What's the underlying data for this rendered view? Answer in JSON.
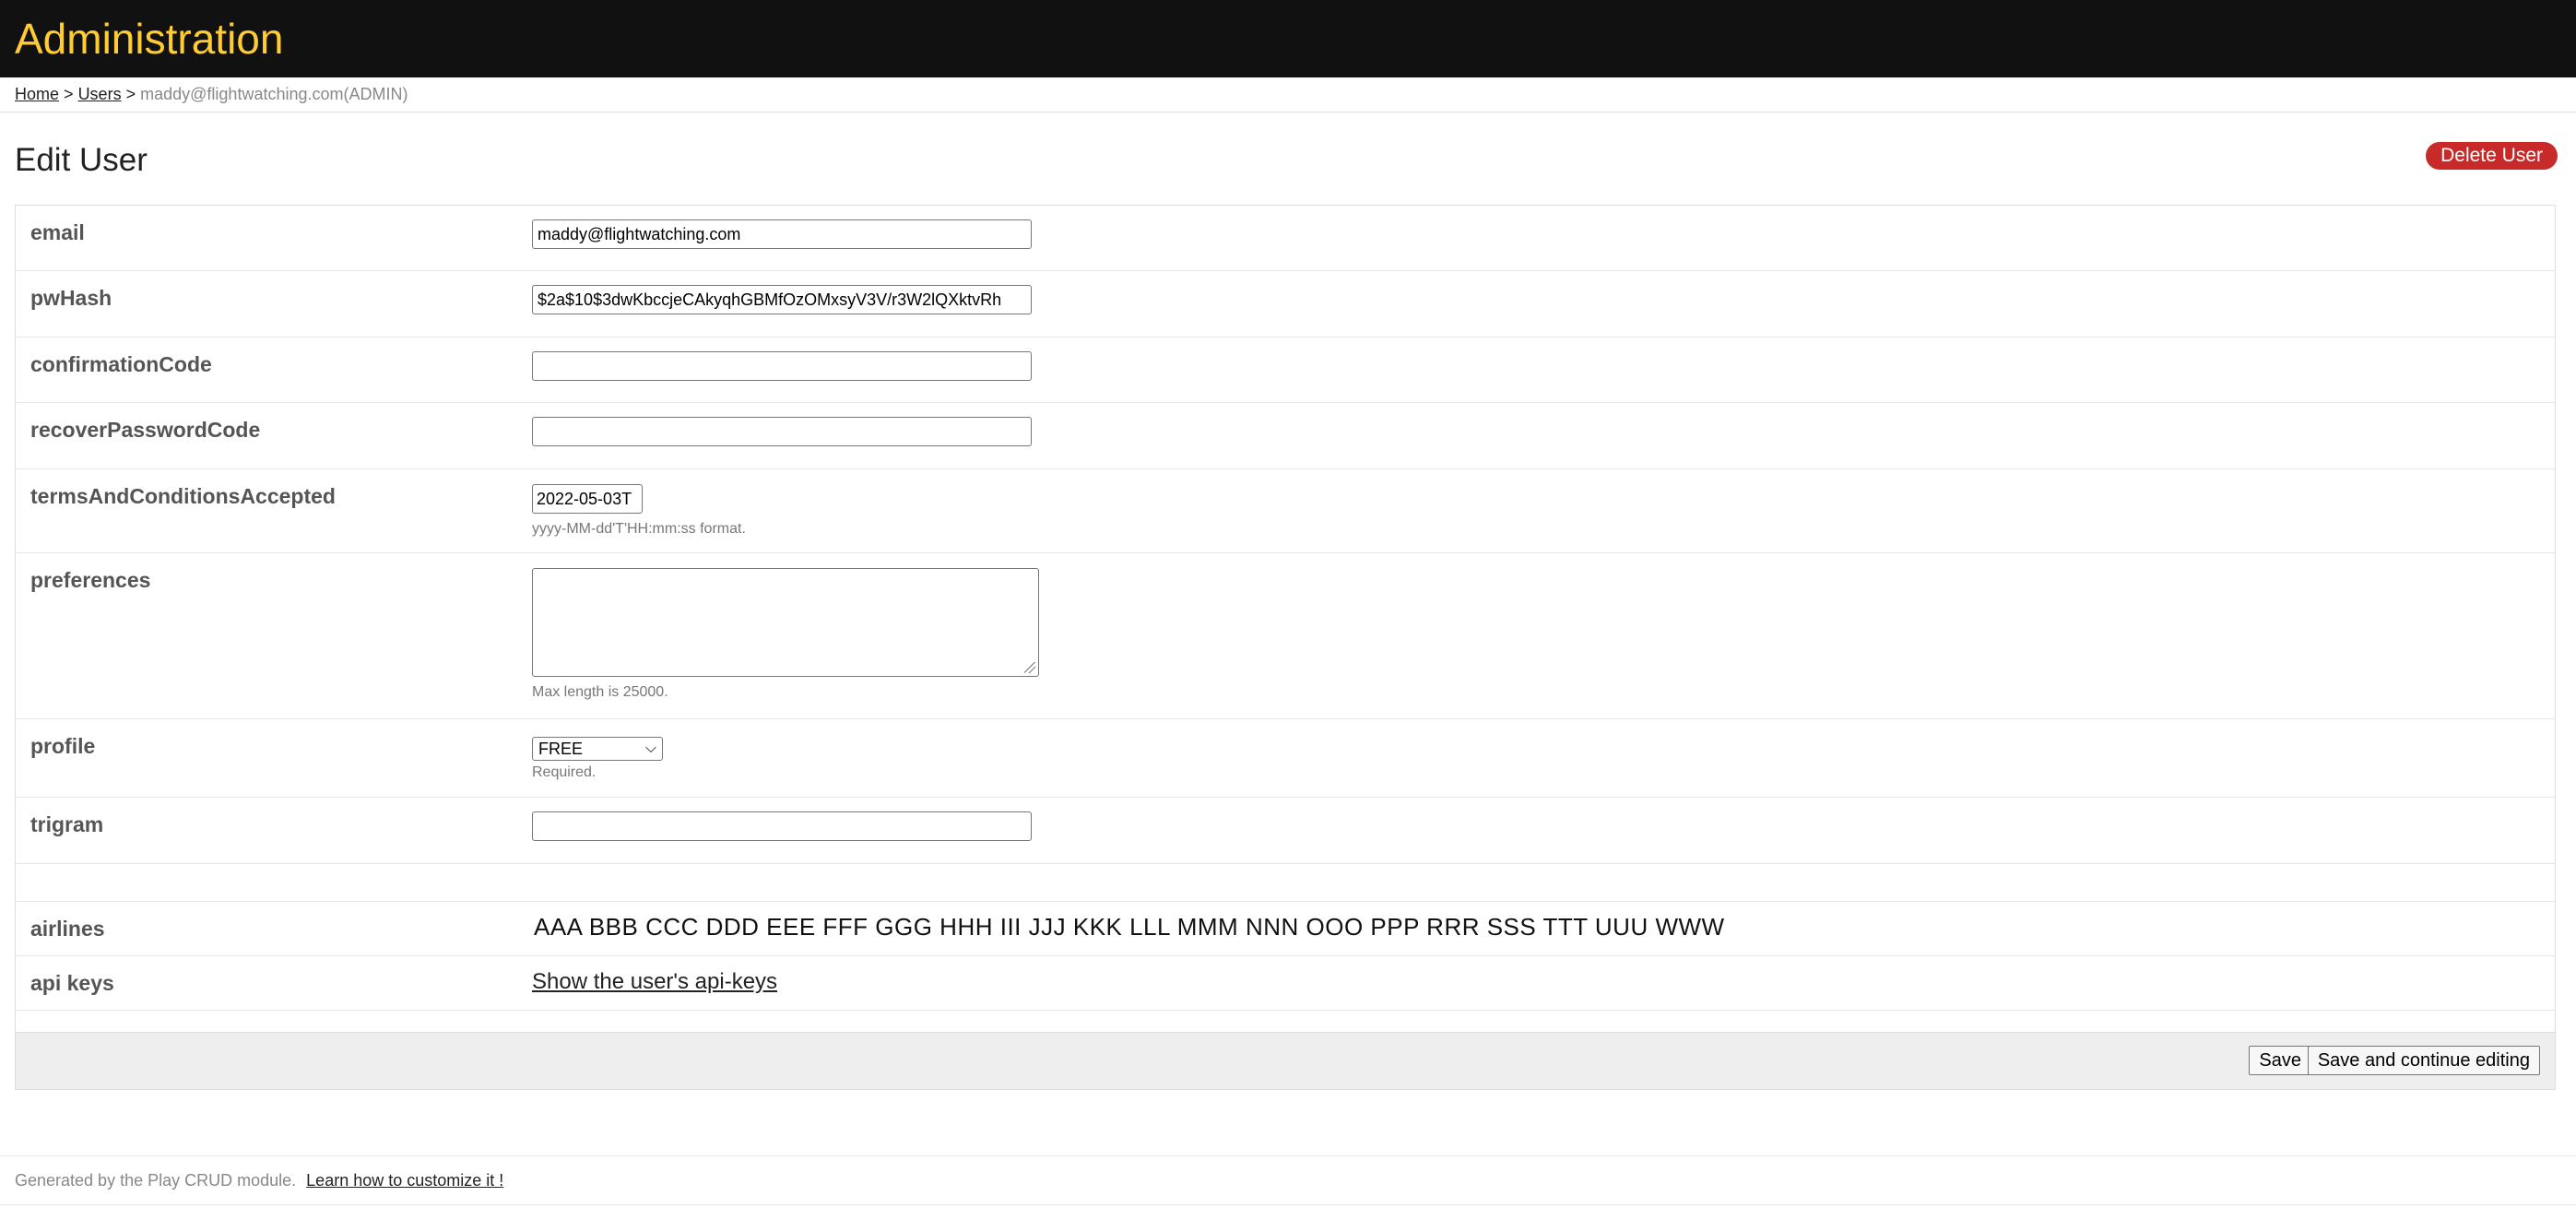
{
  "app_title": "Administration",
  "breadcrumb": {
    "home": "Home",
    "sep1": ">",
    "users": "Users",
    "sep2": ">",
    "current": "maddy@flightwatching.com(ADMIN)"
  },
  "page_title": "Edit User",
  "delete_button": "Delete User",
  "fields": {
    "email": {
      "label": "email",
      "value": "maddy@flightwatching.com"
    },
    "pwHash": {
      "label": "pwHash",
      "value": "$2a$10$3dwKbccjeCAkyqhGBMfOzOMxsyV3V/r3W2lQXktvRh"
    },
    "confirmationCode": {
      "label": "confirmationCode",
      "value": ""
    },
    "recoverPasswordCode": {
      "label": "recoverPasswordCode",
      "value": ""
    },
    "termsAndConditionsAccepted": {
      "label": "termsAndConditionsAccepted",
      "value": "2022-05-03T",
      "hint": "yyyy-MM-dd'T'HH:mm:ss format."
    },
    "preferences": {
      "label": "preferences",
      "value": "",
      "hint": "Max length is 25000."
    },
    "profile": {
      "label": "profile",
      "value": "FREE",
      "hint": "Required."
    },
    "trigram": {
      "label": "trigram",
      "value": ""
    },
    "airlines": {
      "label": "airlines",
      "value": "AAA BBB CCC DDD EEE FFF GGG HHH III JJJ KKK LLL MMM NNN OOO PPP RRR SSS TTT UUU WWW"
    },
    "api_keys": {
      "label": "api keys",
      "link": "Show the user's api-keys"
    }
  },
  "buttons": {
    "save": "Save",
    "save_continue": "Save and continue editing"
  },
  "footer": {
    "generated": "Generated by the Play CRUD module.",
    "link": "Learn how to customize it !"
  },
  "colors": {
    "header_bg": "#111111",
    "title_accent": "#ffcc33",
    "delete": "#c82a2a"
  }
}
